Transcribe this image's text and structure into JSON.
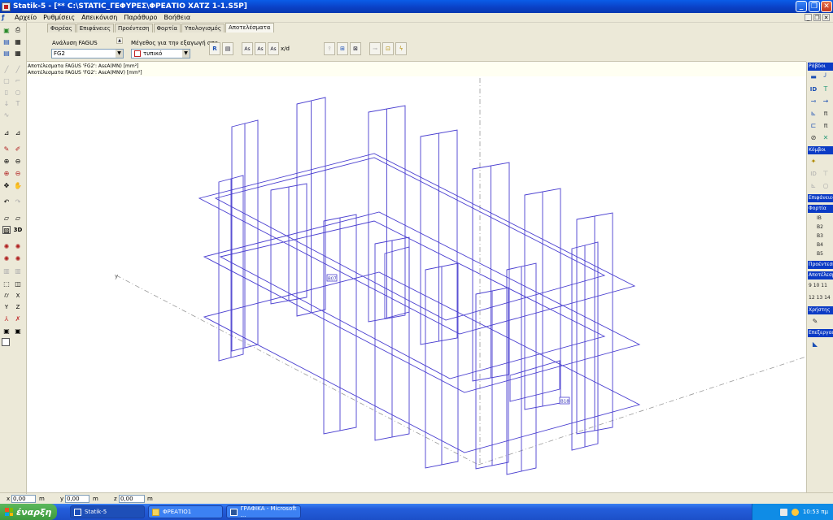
{
  "window": {
    "title": "Statik-5 - [** C:\\STATIC_ΓΕΦΥΡΕΣ\\ΦΡΕΑΤΙΟ ΧΑΤΖ 1-1.S5P]"
  },
  "menu": [
    "Αρχείο",
    "Ρυθμίσεις",
    "Απεικόνιση",
    "Παράθυρο",
    "Βοήθεια"
  ],
  "tabs": [
    "Φορέας",
    "Επιφάνειες",
    "Προέντεση",
    "Φορτία",
    "Υπολογισμός",
    "Αποτελέσματα"
  ],
  "toolbar": {
    "analysis_label": "Ανάλυση FAGUS",
    "analysis_value": "FG2",
    "size_label": "Μέγεθος για την εξαγωγή απο",
    "size_value": "τυπικό",
    "xd_label": "x/d"
  },
  "status_lines": [
    "Αποτέλεσματα FAGUS 'FG2':  AsεA(MN) [mm²]",
    "Αποτέλεσματα FAGUS 'FG2':  AsεA(MNV) [mm²]"
  ],
  "canvas": {
    "axis_label": "y",
    "tags": [
      "B07",
      "B18"
    ],
    "line_color": "#4a3fd0"
  },
  "right_panel": {
    "headers": [
      "Ράβδοι",
      "Κόμβοι",
      "Επιφάνειες",
      "Φορτία",
      "Προέντεση",
      "Αποτέλεσμα",
      "Χρήστης",
      "Επεξεργασ"
    ],
    "loads": [
      "IB",
      "B2",
      "B3",
      "B4",
      "B5"
    ],
    "results": [
      "9 10 11",
      "12 13 14"
    ]
  },
  "coords": {
    "x_label": "x",
    "x": "0,00",
    "y_label": "y",
    "y": "0,00",
    "z_label": "z",
    "z": "0,00",
    "unit": "m"
  },
  "taskbar": {
    "start": "έναρξη",
    "tasks": [
      "Statik-5",
      "ΦΡΕΑΤΙΟ1",
      "ΓΡΑΦΙΚΑ - Microsoft ..."
    ],
    "clock": "10:53 πμ"
  },
  "colors": {
    "title_blue": "#0a5ce8",
    "panel_header": "#0b3bc5",
    "drawing": "#4a3fd0"
  }
}
